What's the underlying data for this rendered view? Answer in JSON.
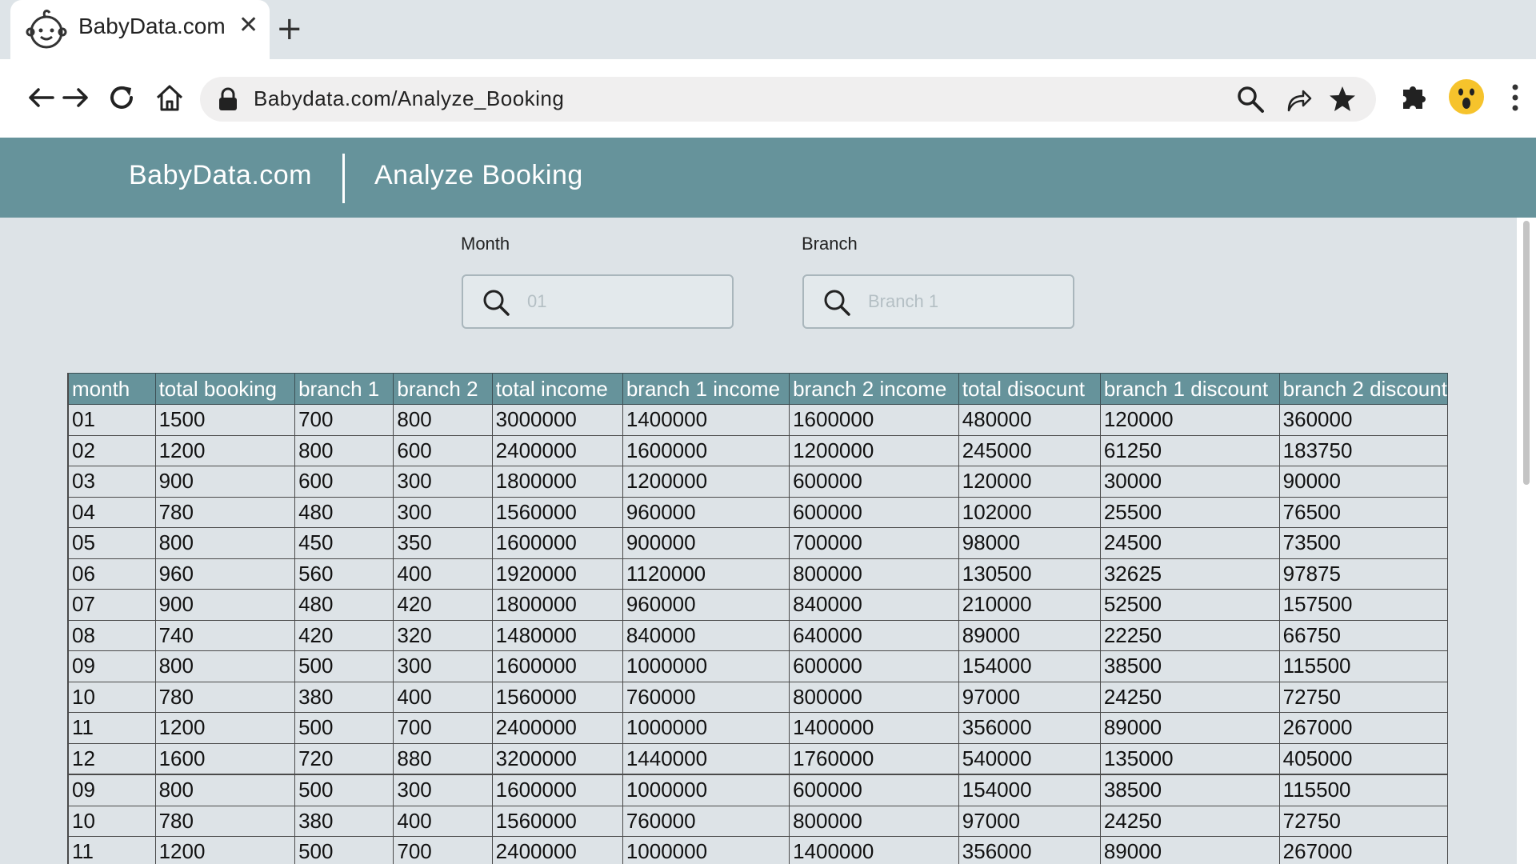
{
  "browser": {
    "tab_title": "BabyData.com",
    "tab_close": "✕",
    "new_tab": "+",
    "url": "Babydata.com/Analyze_Booking"
  },
  "header": {
    "brand": "BabyData.com",
    "title": "Analyze Booking"
  },
  "filters": {
    "month_label": "Month",
    "month_placeholder": "01",
    "branch_label": "Branch",
    "branch_placeholder": "Branch 1"
  },
  "table": {
    "columns": [
      "month",
      "total booking",
      "branch 1",
      "branch 2",
      "total income",
      "branch 1 income",
      "branch 2 income",
      "total disocunt",
      "branch 1 discount",
      "branch 2 discount"
    ],
    "rows": [
      [
        "01",
        "1500",
        "700",
        "800",
        "3000000",
        "1400000",
        "1600000",
        "480000",
        "120000",
        "360000"
      ],
      [
        "02",
        "1200",
        "800",
        "600",
        "2400000",
        "1600000",
        "1200000",
        "245000",
        "61250",
        "183750"
      ],
      [
        "03",
        "900",
        "600",
        "300",
        "1800000",
        "1200000",
        "600000",
        "120000",
        "30000",
        "90000"
      ],
      [
        "04",
        "780",
        "480",
        "300",
        "1560000",
        "960000",
        "600000",
        "102000",
        "25500",
        "76500"
      ],
      [
        "05",
        "800",
        "450",
        "350",
        "1600000",
        "900000",
        "700000",
        "98000",
        "24500",
        "73500"
      ],
      [
        "06",
        "960",
        "560",
        "400",
        "1920000",
        "1120000",
        "800000",
        "130500",
        "32625",
        "97875"
      ],
      [
        "07",
        "900",
        "480",
        "420",
        "1800000",
        "960000",
        "840000",
        "210000",
        "52500",
        "157500"
      ],
      [
        "08",
        "740",
        "420",
        "320",
        "1480000",
        "840000",
        "640000",
        "89000",
        "22250",
        "66750"
      ],
      [
        "09",
        "800",
        "500",
        "300",
        "1600000",
        "1000000",
        "600000",
        "154000",
        "38500",
        "115500"
      ],
      [
        "10",
        "780",
        "380",
        "400",
        "1560000",
        "760000",
        "800000",
        "97000",
        "24250",
        "72750"
      ],
      [
        "11",
        "1200",
        "500",
        "700",
        "2400000",
        "1000000",
        "1400000",
        "356000",
        "89000",
        "267000"
      ],
      [
        "12",
        "1600",
        "720",
        "880",
        "3200000",
        "1440000",
        "1760000",
        "540000",
        "135000",
        "405000"
      ],
      [
        "09",
        "800",
        "500",
        "300",
        "1600000",
        "1000000",
        "600000",
        "154000",
        "38500",
        "115500"
      ],
      [
        "10",
        "780",
        "380",
        "400",
        "1560000",
        "760000",
        "800000",
        "97000",
        "24250",
        "72750"
      ],
      [
        "11",
        "1200",
        "500",
        "700",
        "2400000",
        "1000000",
        "1400000",
        "356000",
        "89000",
        "267000"
      ]
    ]
  },
  "colors": {
    "header_bg": "#66939b",
    "page_bg": "#dde3e7",
    "tab_strip_bg": "#dee4e8"
  },
  "icons": {
    "tab": "baby-face-icon",
    "back": "back-arrow-icon",
    "forward": "forward-arrow-icon",
    "reload": "reload-icon",
    "home": "home-icon",
    "lock": "lock-icon",
    "search": "search-icon",
    "share": "share-icon",
    "bookmark": "star-icon",
    "extensions": "puzzle-icon",
    "profile": "surprised-face-icon",
    "menu": "kebab-menu-icon"
  }
}
